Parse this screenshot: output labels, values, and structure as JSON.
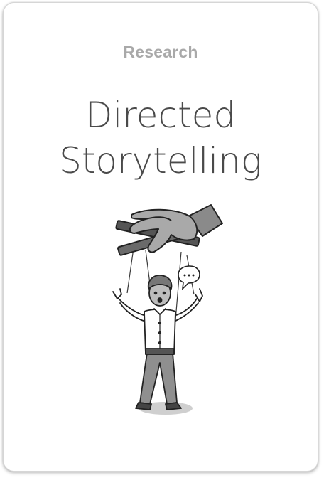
{
  "card": {
    "category": "Research",
    "title_line_1": "Directed",
    "title_line_2": "Storytelling",
    "illustration": "puppet-on-strings-illustration"
  },
  "colors": {
    "background": "#ffffff",
    "category_text": "#a9a9a9",
    "title_text": "#4a4a4a",
    "card_border": "#d6d6d6"
  }
}
